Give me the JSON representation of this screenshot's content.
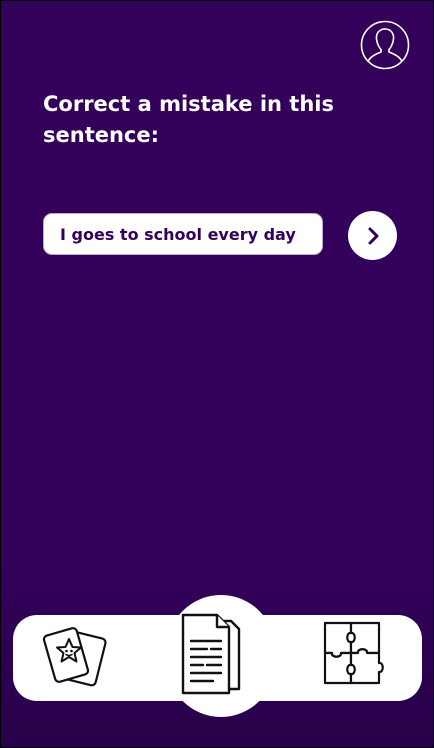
{
  "header": {
    "profile_icon": "user-profile-icon"
  },
  "exercise": {
    "prompt": "Correct a mistake in this sentence:",
    "sentence_value": "I goes to school every day",
    "submit_icon": "chevron-right-icon"
  },
  "bottom_nav": {
    "items": [
      {
        "icon": "flashcards-icon",
        "active": false
      },
      {
        "icon": "documents-icon",
        "active": true
      },
      {
        "icon": "puzzle-icon",
        "active": false
      }
    ]
  },
  "colors": {
    "background": "#33005a",
    "surface": "#ffffff",
    "input_text": "#33005a",
    "icon_stroke": "#111111"
  }
}
